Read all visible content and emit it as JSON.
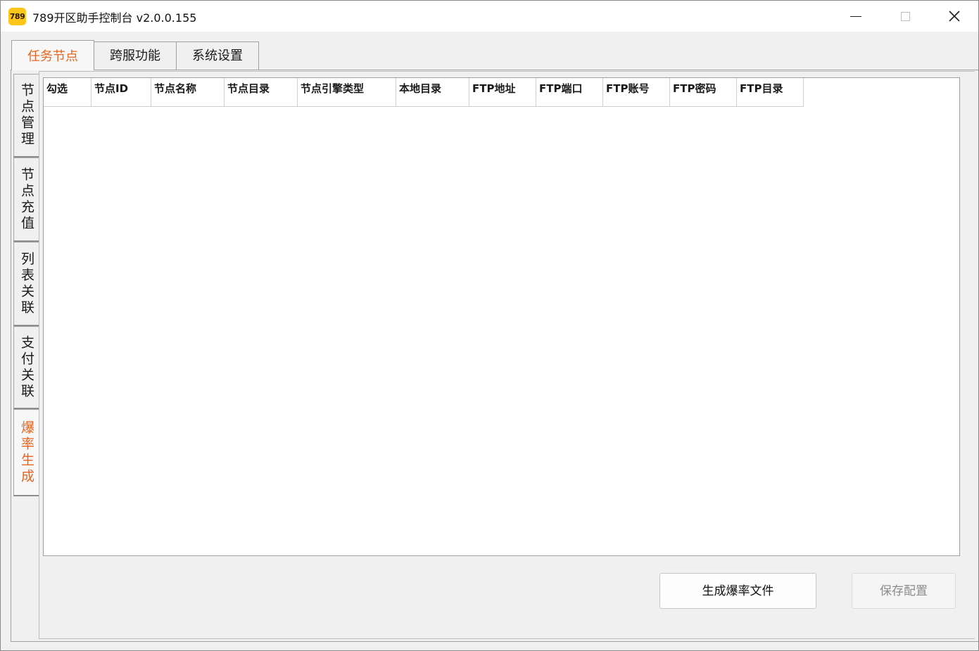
{
  "window": {
    "icon_text": "789",
    "title": "789开区助手控制台 v2.0.0.155"
  },
  "top_tabs": [
    {
      "label": "任务节点",
      "active": true
    },
    {
      "label": "跨服功能",
      "active": false
    },
    {
      "label": "系统设置",
      "active": false
    }
  ],
  "side_tabs": [
    {
      "label": "节点管理",
      "active": false
    },
    {
      "label": "节点充值",
      "active": false
    },
    {
      "label": "列表关联",
      "active": false
    },
    {
      "label": "支付关联",
      "active": false
    },
    {
      "label": "爆率生成",
      "active": true
    }
  ],
  "grid": {
    "columns": [
      "勾选",
      "节点ID",
      "节点名称",
      "节点目录",
      "节点引擎类型",
      "本地目录",
      "FTP地址",
      "FTP端口",
      "FTP账号",
      "FTP密码",
      "FTP目录"
    ],
    "rows": []
  },
  "buttons": {
    "generate": "生成爆率文件",
    "save": "保存配置"
  },
  "colors": {
    "accent": "#e8641c",
    "icon_bg": "#ffc61a"
  }
}
